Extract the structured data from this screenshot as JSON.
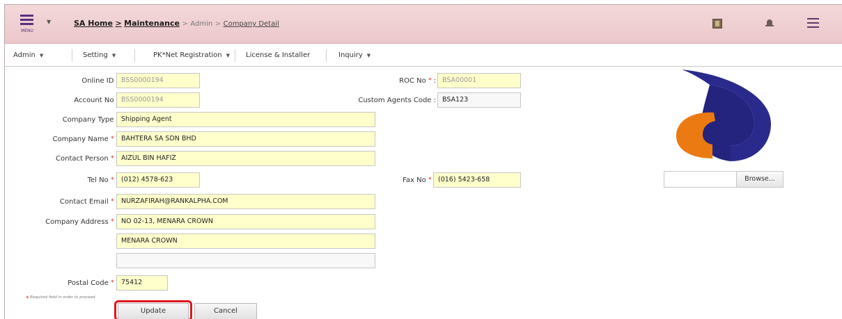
{
  "header": {
    "menu_label": "MENU",
    "breadcrumb": {
      "home": "SA Home",
      "sep1": ">",
      "maintenance": "Maintenance",
      "sep2": ">",
      "admin": "Admin",
      "sep3": ">",
      "current": "Company Detail"
    },
    "icons": [
      "book-icon",
      "bell-icon",
      "hamburger-icon"
    ]
  },
  "nav": {
    "items": [
      {
        "label": "Admin",
        "has_dropdown": true
      },
      {
        "label": "Setting",
        "has_dropdown": true
      },
      {
        "label": "PK*Net Registration",
        "has_dropdown": true
      },
      {
        "label": "License & Installer",
        "has_dropdown": false
      },
      {
        "label": "Inquiry",
        "has_dropdown": true
      }
    ],
    "caret": "▼"
  },
  "form": {
    "online_id": {
      "label": "Online ID",
      "value": "BSS0000194"
    },
    "account_no": {
      "label": "Account No",
      "value": "BSS0000194"
    },
    "company_type": {
      "label": "Company Type",
      "value": "Shipping Agent"
    },
    "company_name": {
      "label": "Company Name",
      "value": "BAHTERA SA SDN BHD"
    },
    "contact_person": {
      "label": "Contact Person",
      "value": "AIZUL BIN HAFIZ"
    },
    "tel_no": {
      "label": "Tel No",
      "value": "(012) 4578-623"
    },
    "contact_email": {
      "label": "Contact Email",
      "value": "NURZAFIRAH@RANKALPHA.COM"
    },
    "company_address": {
      "label": "Company Address",
      "line1": "NO 02-13, MENARA CROWN",
      "line2": "MENARA CROWN",
      "line3": ""
    },
    "postal_code": {
      "label": "Postal Code",
      "value": "75412"
    },
    "roc_no": {
      "label": "ROC No",
      "value": "BSA00001"
    },
    "custom_agents_code": {
      "label": "Custom Agents Code",
      "value": "BSA123"
    },
    "fax_no": {
      "label": "Fax No",
      "value": "(016) 5423-658"
    },
    "required_mark": "*",
    "colon": ":",
    "required_note": "Required field in order to proceed"
  },
  "logo_upload": {
    "browse_label": "Browse..."
  },
  "actions": {
    "update_label": "Update",
    "cancel_label": "Cancel"
  },
  "colors": {
    "header_bg": "#ecc8cb",
    "field_bg": "#ffffcc",
    "required": "#e0201c",
    "highlight": "#e0141e"
  }
}
